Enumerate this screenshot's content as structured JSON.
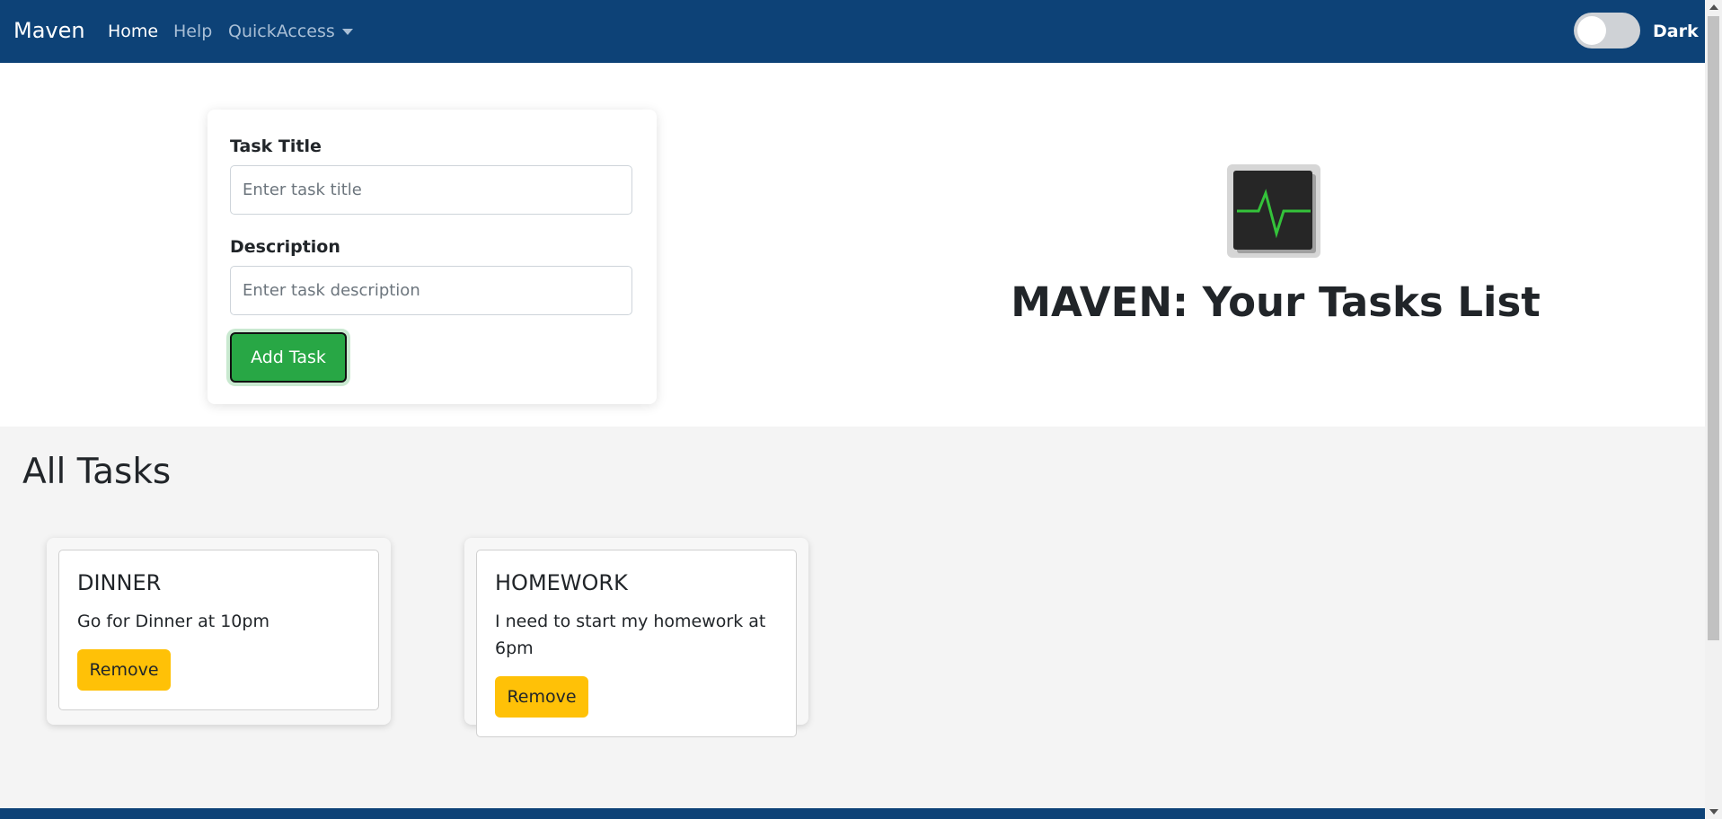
{
  "navbar": {
    "brand": "Maven",
    "links": {
      "home": "Home",
      "help": "Help",
      "quick_access": "QuickAccess"
    },
    "theme_toggle": {
      "label": "Dark",
      "enabled": false
    }
  },
  "form": {
    "title_label": "Task Title",
    "title_placeholder": "Enter task title",
    "title_value": "",
    "description_label": "Description",
    "description_placeholder": "Enter task description",
    "description_value": "",
    "submit_label": "Add Task"
  },
  "hero": {
    "icon": "activity-monitor-icon",
    "title": "MAVEN: Your Tasks List"
  },
  "tasks": {
    "heading": "All Tasks",
    "items": [
      {
        "title": "DINNER",
        "description": "Go for Dinner at 10pm",
        "remove_label": "Remove"
      },
      {
        "title": "HOMEWORK",
        "description": "I need to start my homework at 6pm",
        "remove_label": "Remove"
      }
    ]
  },
  "colors": {
    "navbar": "#0d4277",
    "primary_action": "#28a745",
    "remove_action": "#ffc107",
    "section_bg": "#f4f4f4"
  }
}
